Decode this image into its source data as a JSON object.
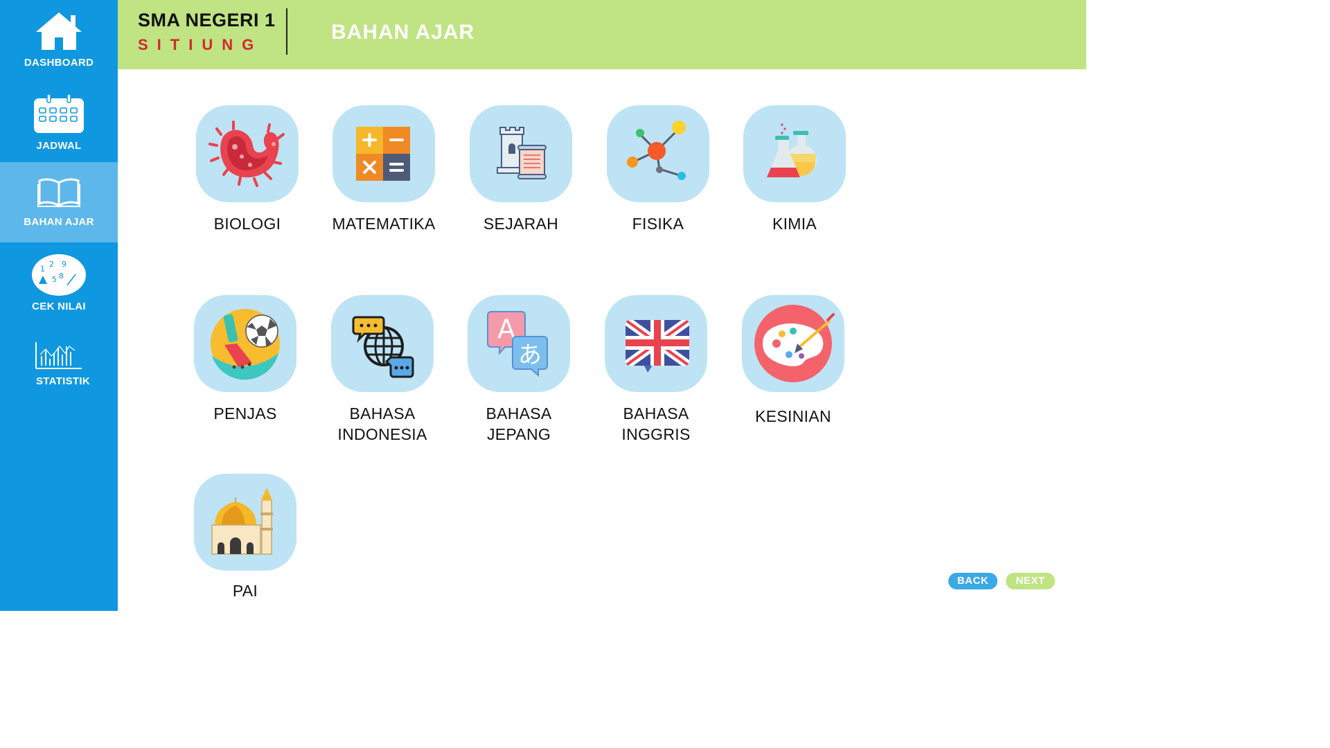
{
  "header": {
    "school_name": "SMA NEGERI 1",
    "school_city": "SITIUNG",
    "page_title": "BAHAN AJAR"
  },
  "sidebar": {
    "items": [
      {
        "label": "DASHBOARD",
        "icon": "home-icon"
      },
      {
        "label": "JADWAL",
        "icon": "calendar-icon"
      },
      {
        "label": "BAHAN AJAR",
        "icon": "book-icon",
        "active": true
      },
      {
        "label": "CEK NILAI",
        "icon": "grades-icon"
      },
      {
        "label": "STATISTIK",
        "icon": "statistics-icon"
      }
    ]
  },
  "subjects": [
    {
      "label": "BIOLOGI",
      "icon": "bacteria-icon"
    },
    {
      "label": "MATEMATIKA",
      "icon": "calculator-icon"
    },
    {
      "label": "SEJARAH",
      "icon": "castle-scroll-icon"
    },
    {
      "label": "FISIKA",
      "icon": "molecule-icon"
    },
    {
      "label": "KIMIA",
      "icon": "flask-icon"
    },
    {
      "label": "PENJAS",
      "icon": "soccer-icon"
    },
    {
      "label": "BAHASA\nINDONESIA",
      "icon": "globe-chat-icon"
    },
    {
      "label": "BAHASA\nJEPANG",
      "icon": "translate-icon"
    },
    {
      "label": "BAHASA\nINGGRIS",
      "icon": "uk-flag-icon"
    },
    {
      "label": "KESINIAN",
      "icon": "paint-palette-icon"
    },
    {
      "label": "PAI",
      "icon": "mosque-icon"
    }
  ],
  "footer": {
    "back_label": "BACK",
    "next_label": "NEXT"
  },
  "colors": {
    "sidebar": "#0f97df",
    "sidebar_active": "#5db7ea",
    "header": "#c0e383",
    "tile": "#bde3f5",
    "city": "#d4262d",
    "back": "#3aa9e6",
    "next": "#c0e383"
  }
}
